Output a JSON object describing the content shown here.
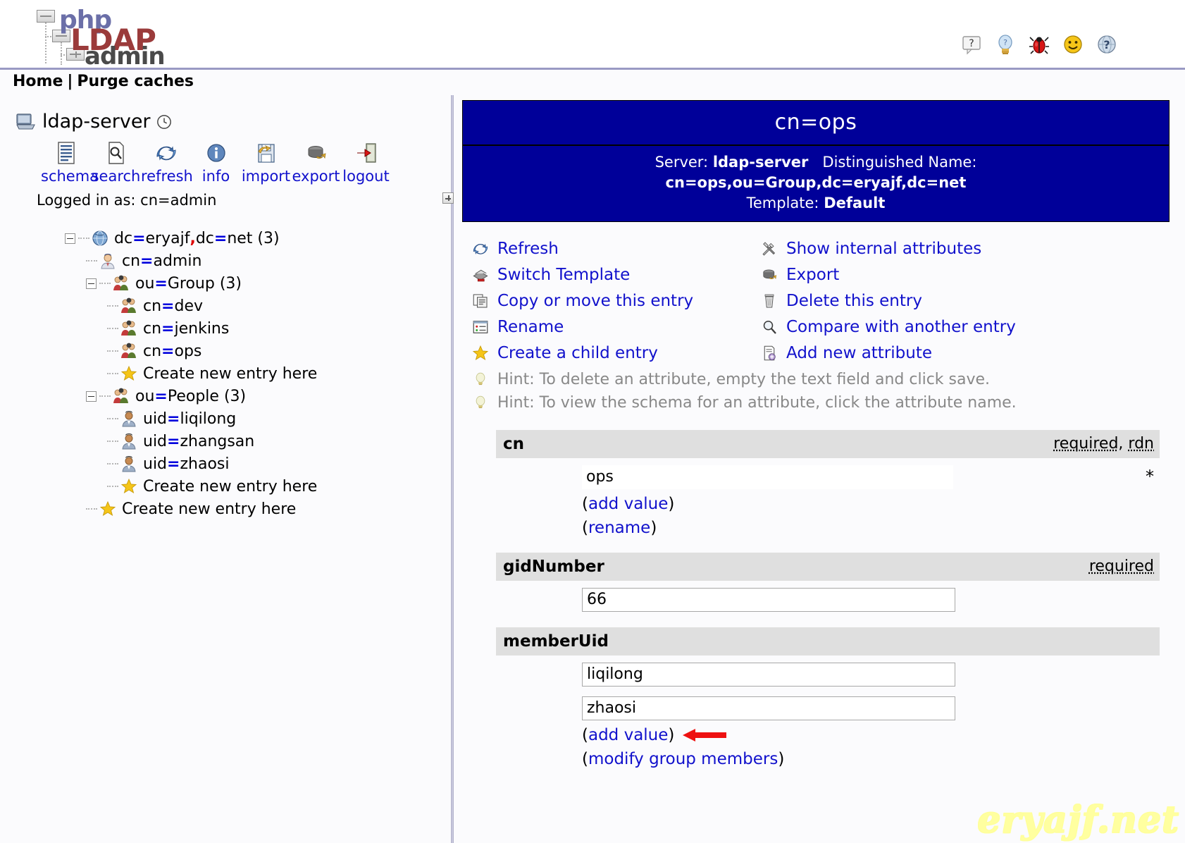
{
  "app": {
    "logo_php": "php",
    "logo_ldap": "LDAP",
    "logo_admin": "admin"
  },
  "header_icons": [
    {
      "name": "help-bubble-icon",
      "label": "?"
    },
    {
      "name": "lightbulb-icon",
      "label": "?"
    },
    {
      "name": "bug-icon",
      "label": ""
    },
    {
      "name": "smiley-icon",
      "label": ""
    },
    {
      "name": "help-globe-icon",
      "label": "?"
    }
  ],
  "navbar": {
    "home": "Home",
    "separator": "|",
    "purge": "Purge caches"
  },
  "sidebar": {
    "server_name": "ldap-server",
    "logged_in": "Logged in as: cn=admin",
    "toolbar": [
      {
        "label": "schema",
        "icon": "schema-icon"
      },
      {
        "label": "search",
        "icon": "search-icon"
      },
      {
        "label": "refresh",
        "icon": "refresh-icon"
      },
      {
        "label": "info",
        "icon": "info-icon"
      },
      {
        "label": "import",
        "icon": "import-icon"
      },
      {
        "label": "export",
        "icon": "export-icon"
      },
      {
        "label": "logout",
        "icon": "logout-icon"
      }
    ],
    "tree": [
      {
        "indent": 1,
        "expander": true,
        "icon": "globe-icon",
        "prefix": "dc",
        "value": "eryajf",
        "extra_prefix": "dc",
        "extra_value": "net",
        "count": "(3)"
      },
      {
        "indent": 2,
        "expander": false,
        "icon": "admin-user-icon",
        "prefix": "cn",
        "value": "admin",
        "count": ""
      },
      {
        "indent": 2,
        "expander": true,
        "icon": "group-icon",
        "prefix": "ou",
        "value": "Group",
        "count": "(3)"
      },
      {
        "indent": 3,
        "expander": false,
        "icon": "group-icon",
        "prefix": "cn",
        "value": "dev",
        "count": ""
      },
      {
        "indent": 3,
        "expander": false,
        "icon": "group-icon",
        "prefix": "cn",
        "value": "jenkins",
        "count": ""
      },
      {
        "indent": 3,
        "expander": false,
        "icon": "group-icon",
        "prefix": "cn",
        "value": "ops",
        "count": ""
      },
      {
        "indent": 3,
        "expander": false,
        "icon": "star-icon",
        "plain": "Create new entry here"
      },
      {
        "indent": 2,
        "expander": true,
        "icon": "group-icon",
        "prefix": "ou",
        "value": "People",
        "count": "(3)"
      },
      {
        "indent": 3,
        "expander": false,
        "icon": "user-icon",
        "prefix": "uid",
        "value": "liqilong",
        "count": ""
      },
      {
        "indent": 3,
        "expander": false,
        "icon": "user-icon",
        "prefix": "uid",
        "value": "zhangsan",
        "count": ""
      },
      {
        "indent": 3,
        "expander": false,
        "icon": "user-icon",
        "prefix": "uid",
        "value": "zhaosi",
        "count": ""
      },
      {
        "indent": 3,
        "expander": false,
        "icon": "star-icon",
        "plain": "Create new entry here"
      },
      {
        "indent": 2,
        "expander": false,
        "icon": "star-icon",
        "plain": "Create new entry here"
      }
    ]
  },
  "entry": {
    "title": "cn=ops",
    "server_label": "Server:",
    "server_value": "ldap-server",
    "dn_label": "Distinguished Name:",
    "dn_value": "cn=ops,ou=Group,dc=eryajf,dc=net",
    "template_label": "Template:",
    "template_value": "Default"
  },
  "actions_left": [
    {
      "label": "Refresh",
      "icon": "refresh-icon"
    },
    {
      "label": "Switch Template",
      "icon": "switch-template-icon"
    },
    {
      "label": "Copy or move this entry",
      "icon": "copy-icon"
    },
    {
      "label": "Rename",
      "icon": "rename-icon"
    },
    {
      "label": "Create a child entry",
      "icon": "star-icon"
    }
  ],
  "actions_right": [
    {
      "label": "Show internal attributes",
      "icon": "tools-icon"
    },
    {
      "label": "Export",
      "icon": "export-icon"
    },
    {
      "label": "Delete this entry",
      "icon": "trash-icon"
    },
    {
      "label": "Compare with another entry",
      "icon": "compare-icon"
    },
    {
      "label": "Add new attribute",
      "icon": "add-attribute-icon"
    }
  ],
  "hints": [
    "Hint: To delete an attribute, empty the text field and click save.",
    "Hint: To view the schema for an attribute, click the attribute name."
  ],
  "attributes": [
    {
      "name": "cn",
      "flags": "required, rdn",
      "flags_parts": [
        "required",
        ", ",
        "rdn"
      ],
      "readonly": true,
      "values": [
        "ops"
      ],
      "star": "*",
      "links": [
        "add value",
        "rename"
      ]
    },
    {
      "name": "gidNumber",
      "flags": "required",
      "flags_parts": [
        "required"
      ],
      "readonly": false,
      "values": [
        "66"
      ],
      "star": "",
      "links": []
    },
    {
      "name": "memberUid",
      "flags": "",
      "flags_parts": [],
      "readonly": false,
      "values": [
        "liqilong",
        "zhaosi"
      ],
      "star": "",
      "links": [
        "add value",
        "modify group members"
      ]
    }
  ],
  "annotation": {
    "arrow": "red-left-arrow",
    "watermark": "eryajf.net"
  },
  "colors": {
    "link": "#1111cc",
    "header_bg": "#000099",
    "attr_head_bg": "#dfdfdf",
    "hint_text": "#888888",
    "arrow": "#ee1111"
  }
}
